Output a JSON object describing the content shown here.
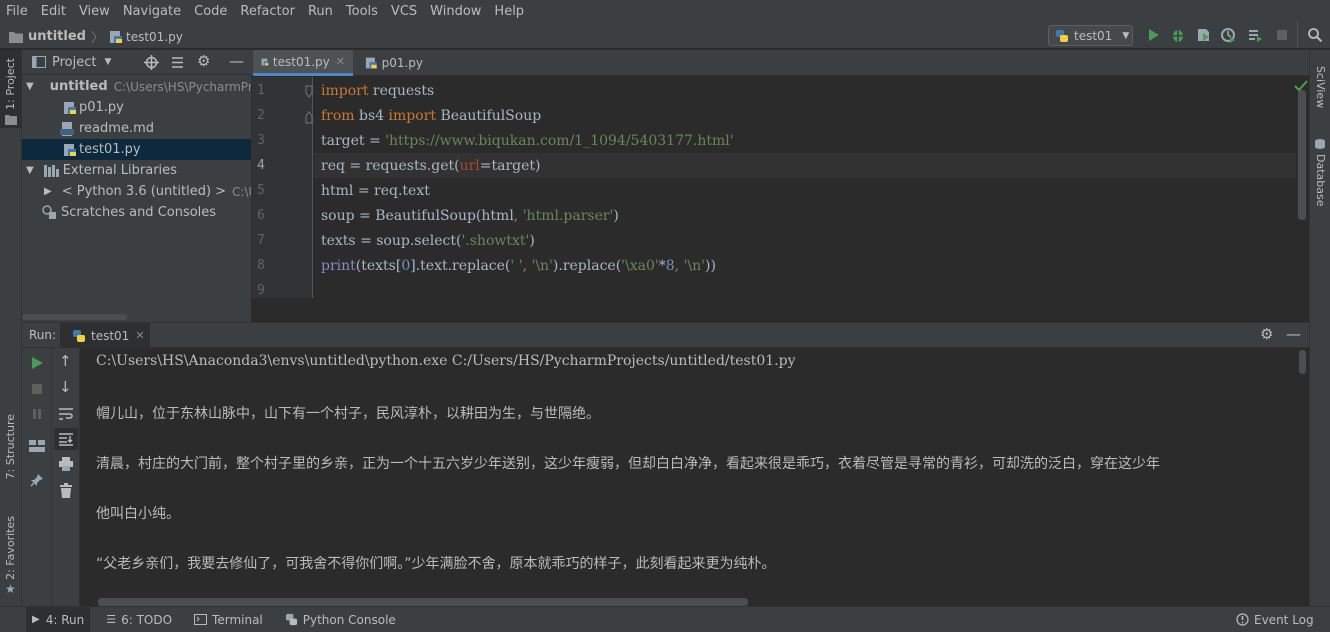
{
  "menu": [
    "File",
    "Edit",
    "View",
    "Navigate",
    "Code",
    "Refactor",
    "Run",
    "Tools",
    "VCS",
    "Window",
    "Help"
  ],
  "navbar": {
    "project": "untitled",
    "file": "test01.py",
    "run_config": "test01"
  },
  "left_strip": {
    "project_label": "1: Project",
    "structure_label": "7: Structure",
    "favorites_label": "2: Favorites"
  },
  "right_strip": {
    "sciview_label": "SciView",
    "database_label": "Database"
  },
  "project_panel": {
    "title": "Project",
    "root_name": "untitled",
    "root_path": "C:\\Users\\HS\\PycharmPr",
    "files": [
      "p01.py",
      "readme.md",
      "test01.py"
    ],
    "external_libraries": "External Libraries",
    "python_sdk": "< Python 3.6 (untitled) >",
    "python_sdk_path": "C:\\U",
    "scratches": "Scratches and Consoles"
  },
  "editor": {
    "tabs": [
      "test01.py",
      "p01.py"
    ],
    "line_numbers": [
      "1",
      "2",
      "3",
      "4",
      "5",
      "6",
      "7",
      "8",
      "9"
    ]
  },
  "run_panel": {
    "label": "Run:",
    "tab": "test01"
  },
  "console": {
    "command": "C:\\Users\\HS\\Anaconda3\\envs\\untitled\\python.exe C:/Users/HS/PycharmProjects/untitled/test01.py",
    "lines": [
      "帽儿山，位于东林山脉中，山下有一个村子，民风淳朴，以耕田为生，与世隔绝。",
      "清晨，村庄的大门前，整个村子里的乡亲，正为一个十五六岁少年送别，这少年瘦弱，但却白白净净，看起来很是乖巧，衣着尽管是寻常的青衫，可却洗的泛白，穿在这少年",
      "他叫白小纯。",
      "“父老乡亲们，我要去修仙了，可我舍不得你们啊。”少年满脸不舍，原本就乖巧的样子，此刻看起来更为纯朴。"
    ]
  },
  "statusbar": {
    "run": "4: Run",
    "todo": "6: TODO",
    "terminal": "Terminal",
    "python_console": "Python Console",
    "event_log": "Event Log"
  }
}
